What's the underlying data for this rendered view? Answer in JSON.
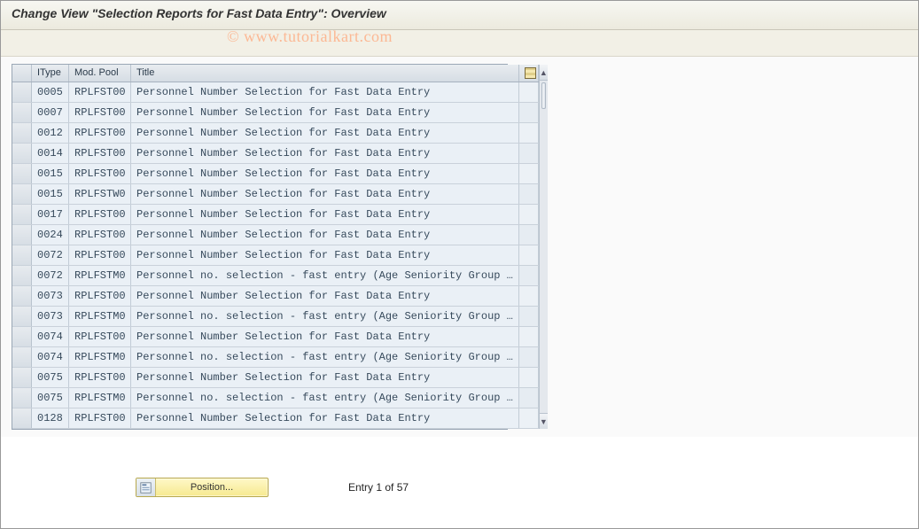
{
  "header": {
    "title": "Change View \"Selection Reports for Fast Data Entry\": Overview"
  },
  "watermark": "© www.tutorialkart.com",
  "grid": {
    "columns": {
      "itype": "IType",
      "modpool": "Mod. Pool",
      "title": "Title"
    },
    "rows": [
      {
        "itype": "0005",
        "modpool": "RPLFST00",
        "title": "Personnel Number Selection for Fast Data Entry"
      },
      {
        "itype": "0007",
        "modpool": "RPLFST00",
        "title": "Personnel Number Selection for Fast Data Entry"
      },
      {
        "itype": "0012",
        "modpool": "RPLFST00",
        "title": "Personnel Number Selection for Fast Data Entry"
      },
      {
        "itype": "0014",
        "modpool": "RPLFST00",
        "title": "Personnel Number Selection for Fast Data Entry"
      },
      {
        "itype": "0015",
        "modpool": "RPLFST00",
        "title": "Personnel Number Selection for Fast Data Entry"
      },
      {
        "itype": "0015",
        "modpool": "RPLFSTW0",
        "title": "Personnel Number Selection for Fast Data Entry"
      },
      {
        "itype": "0017",
        "modpool": "RPLFST00",
        "title": "Personnel Number Selection for Fast Data Entry"
      },
      {
        "itype": "0024",
        "modpool": "RPLFST00",
        "title": "Personnel Number Selection for Fast Data Entry"
      },
      {
        "itype": "0072",
        "modpool": "RPLFST00",
        "title": "Personnel Number Selection for Fast Data Entry"
      },
      {
        "itype": "0072",
        "modpool": "RPLFSTM0",
        "title": "Personnel no. selection - fast entry (Age Seniority Group …"
      },
      {
        "itype": "0073",
        "modpool": "RPLFST00",
        "title": "Personnel Number Selection for Fast Data Entry"
      },
      {
        "itype": "0073",
        "modpool": "RPLFSTM0",
        "title": "Personnel no. selection - fast entry (Age Seniority Group …"
      },
      {
        "itype": "0074",
        "modpool": "RPLFST00",
        "title": "Personnel Number Selection for Fast Data Entry"
      },
      {
        "itype": "0074",
        "modpool": "RPLFSTM0",
        "title": "Personnel no. selection - fast entry (Age Seniority Group …"
      },
      {
        "itype": "0075",
        "modpool": "RPLFST00",
        "title": "Personnel Number Selection for Fast Data Entry"
      },
      {
        "itype": "0075",
        "modpool": "RPLFSTM0",
        "title": "Personnel no. selection - fast entry (Age Seniority Group …"
      },
      {
        "itype": "0128",
        "modpool": "RPLFST00",
        "title": "Personnel Number Selection for Fast Data Entry"
      }
    ]
  },
  "footer": {
    "position_label": "Position...",
    "entry_status": "Entry 1 of 57"
  }
}
